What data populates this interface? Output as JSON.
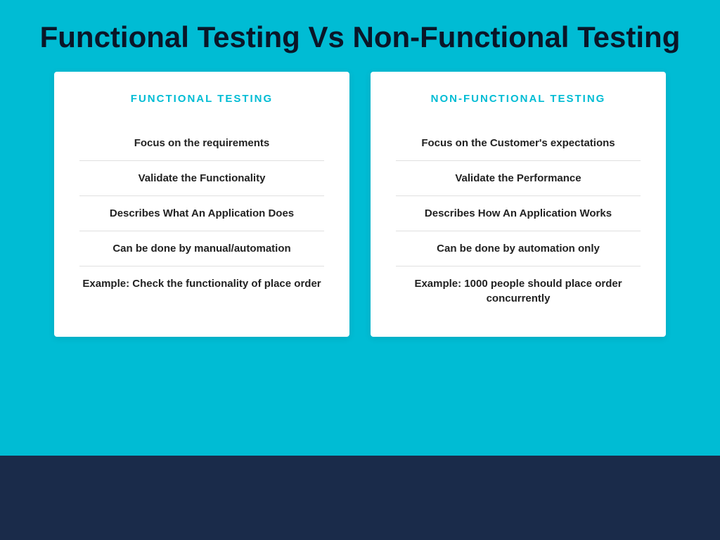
{
  "page": {
    "title": "Functional Testing Vs Non-Functional Testing",
    "background_color": "#00BCD4",
    "bottom_bar_color": "#1A2B4A"
  },
  "cards": [
    {
      "id": "functional",
      "title": "FUNCTIONAL TESTING",
      "items": [
        "Focus on the requirements",
        "Validate the Functionality",
        "Describes What An Application Does",
        "Can be done by manual/automation",
        "Example: Check the functionality of place order"
      ]
    },
    {
      "id": "non-functional",
      "title": "NON-FUNCTIONAL TESTING",
      "items": [
        "Focus on the Customer's expectations",
        "Validate the Performance",
        "Describes How An Application Works",
        "Can be done by automation only",
        "Example: 1000 people should place order concurrently"
      ]
    }
  ]
}
